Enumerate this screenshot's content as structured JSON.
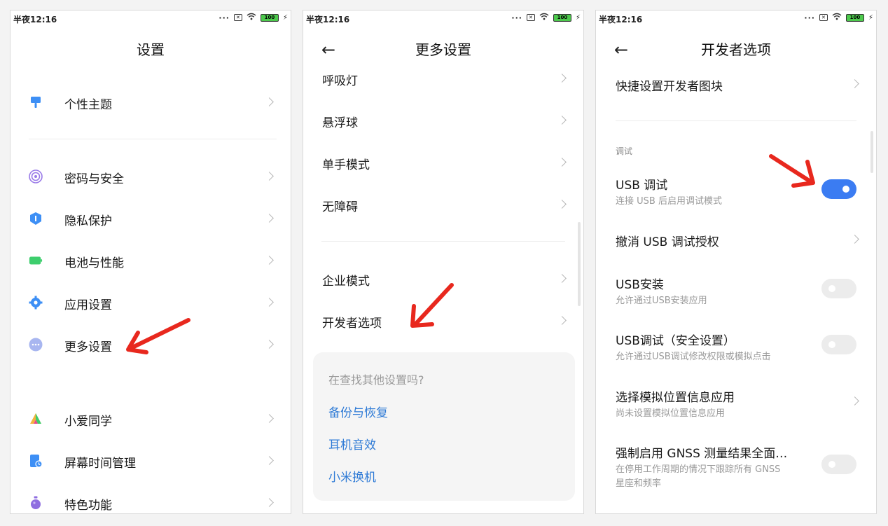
{
  "status": {
    "time": "半夜12:16",
    "battery": "100"
  },
  "screen1": {
    "title": "设置",
    "items": [
      {
        "label": "个性主题",
        "icon": "theme-brush-icon"
      },
      {
        "label": "密码与安全",
        "icon": "fingerprint-icon"
      },
      {
        "label": "隐私保护",
        "icon": "privacy-shield-icon"
      },
      {
        "label": "电池与性能",
        "icon": "battery-icon"
      },
      {
        "label": "应用设置",
        "icon": "gear-icon"
      },
      {
        "label": "更多设置",
        "icon": "more-dots-icon"
      },
      {
        "label": "小爱同学",
        "icon": "assistant-icon"
      },
      {
        "label": "屏幕时间管理",
        "icon": "screen-time-icon"
      },
      {
        "label": "特色功能",
        "icon": "potion-icon"
      }
    ]
  },
  "screen2": {
    "title": "更多设置",
    "items": [
      {
        "label": "呼吸灯"
      },
      {
        "label": "悬浮球"
      },
      {
        "label": "单手模式"
      },
      {
        "label": "无障碍"
      },
      {
        "label": "企业模式"
      },
      {
        "label": "开发者选项"
      }
    ],
    "card": {
      "question": "在查找其他设置吗?",
      "links": [
        "备份与恢复",
        "耳机音效",
        "小米换机"
      ]
    }
  },
  "screen3": {
    "title": "开发者选项",
    "quick_tile": "快捷设置开发者图块",
    "section": "调试",
    "items": [
      {
        "label": "USB 调试",
        "sub": "连接 USB 后启用调试模式",
        "control": "toggle",
        "on": true
      },
      {
        "label": "撤消 USB 调试授权",
        "sub": "",
        "control": "chevron"
      },
      {
        "label": "USB安装",
        "sub": "允许通过USB安装应用",
        "control": "toggle",
        "on": false
      },
      {
        "label": "USB调试（安全设置）",
        "sub": "允许通过USB调试修改权限或模拟点击",
        "control": "toggle",
        "on": false
      },
      {
        "label": "选择模拟位置信息应用",
        "sub": "尚未设置模拟位置信息应用",
        "control": "chevron"
      },
      {
        "label": "强制启用 GNSS 测量结果全面…",
        "sub": "在停用工作周期的情况下跟踪所有 GNSS",
        "sub2": "星座和频率",
        "control": "toggle",
        "on": false
      }
    ]
  },
  "colors": {
    "accent": "#3b7cf2",
    "link": "#2f7bd6",
    "annotation_arrow": "#e8281e"
  }
}
